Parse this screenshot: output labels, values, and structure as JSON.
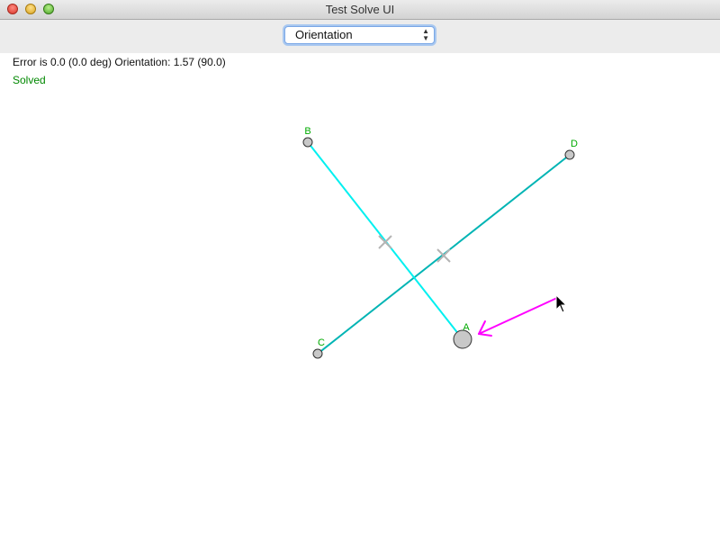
{
  "window": {
    "title": "Test Solve UI"
  },
  "toolbar": {
    "mode_select": {
      "selected": "Orientation"
    }
  },
  "status": {
    "error_text": "Error is 0.0 (0.0 deg) Orientation: 1.57 (90.0)",
    "solved_text": "Solved"
  },
  "canvas": {
    "points": {
      "a": "A",
      "b": "B",
      "c": "C",
      "d": "D"
    }
  },
  "colors": {
    "line_ab": "#00f0f0",
    "line_cd": "#00b4b4",
    "drag_arrow": "#ff00ff",
    "solved": "#008800",
    "point_label": "#00aa00",
    "handle_fill": "#c8c8c8",
    "midpoint_marker": "#b4b4b4"
  }
}
